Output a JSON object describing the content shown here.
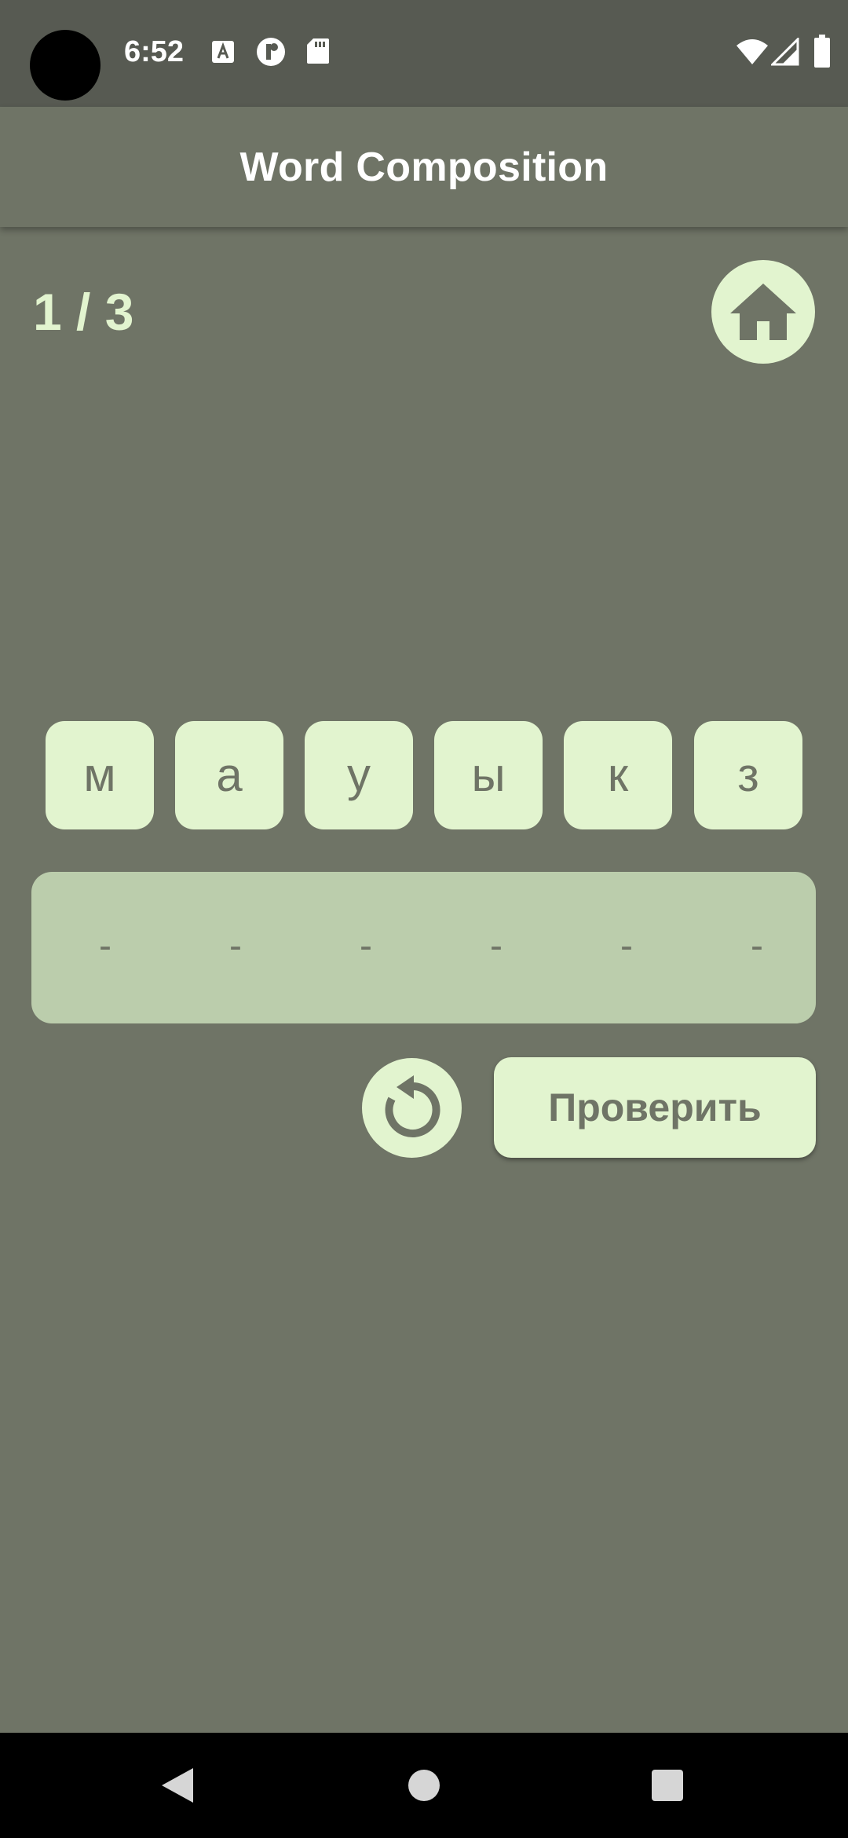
{
  "status_bar": {
    "time": "6:52",
    "left_icons": [
      "font-a-icon",
      "cloud-r-icon",
      "sd-card-icon"
    ],
    "right_icons": [
      "wifi-icon",
      "cell-signal-icon",
      "battery-icon"
    ]
  },
  "app_bar": {
    "title": "Word Composition"
  },
  "progress": {
    "text": "1 / 3"
  },
  "letters": [
    "м",
    "а",
    "у",
    "ы",
    "к",
    "з"
  ],
  "answer_slots": [
    "-",
    "-",
    "-",
    "-",
    "-",
    "-"
  ],
  "actions": {
    "check_label": "Проверить"
  },
  "colors": {
    "background": "#6f7466",
    "accent": "#e2f4cf",
    "answer_box": "#bbcdac",
    "status_bar": "#575a52"
  },
  "nav": {
    "buttons": [
      "back-icon",
      "home-circle-icon",
      "recents-icon"
    ]
  }
}
